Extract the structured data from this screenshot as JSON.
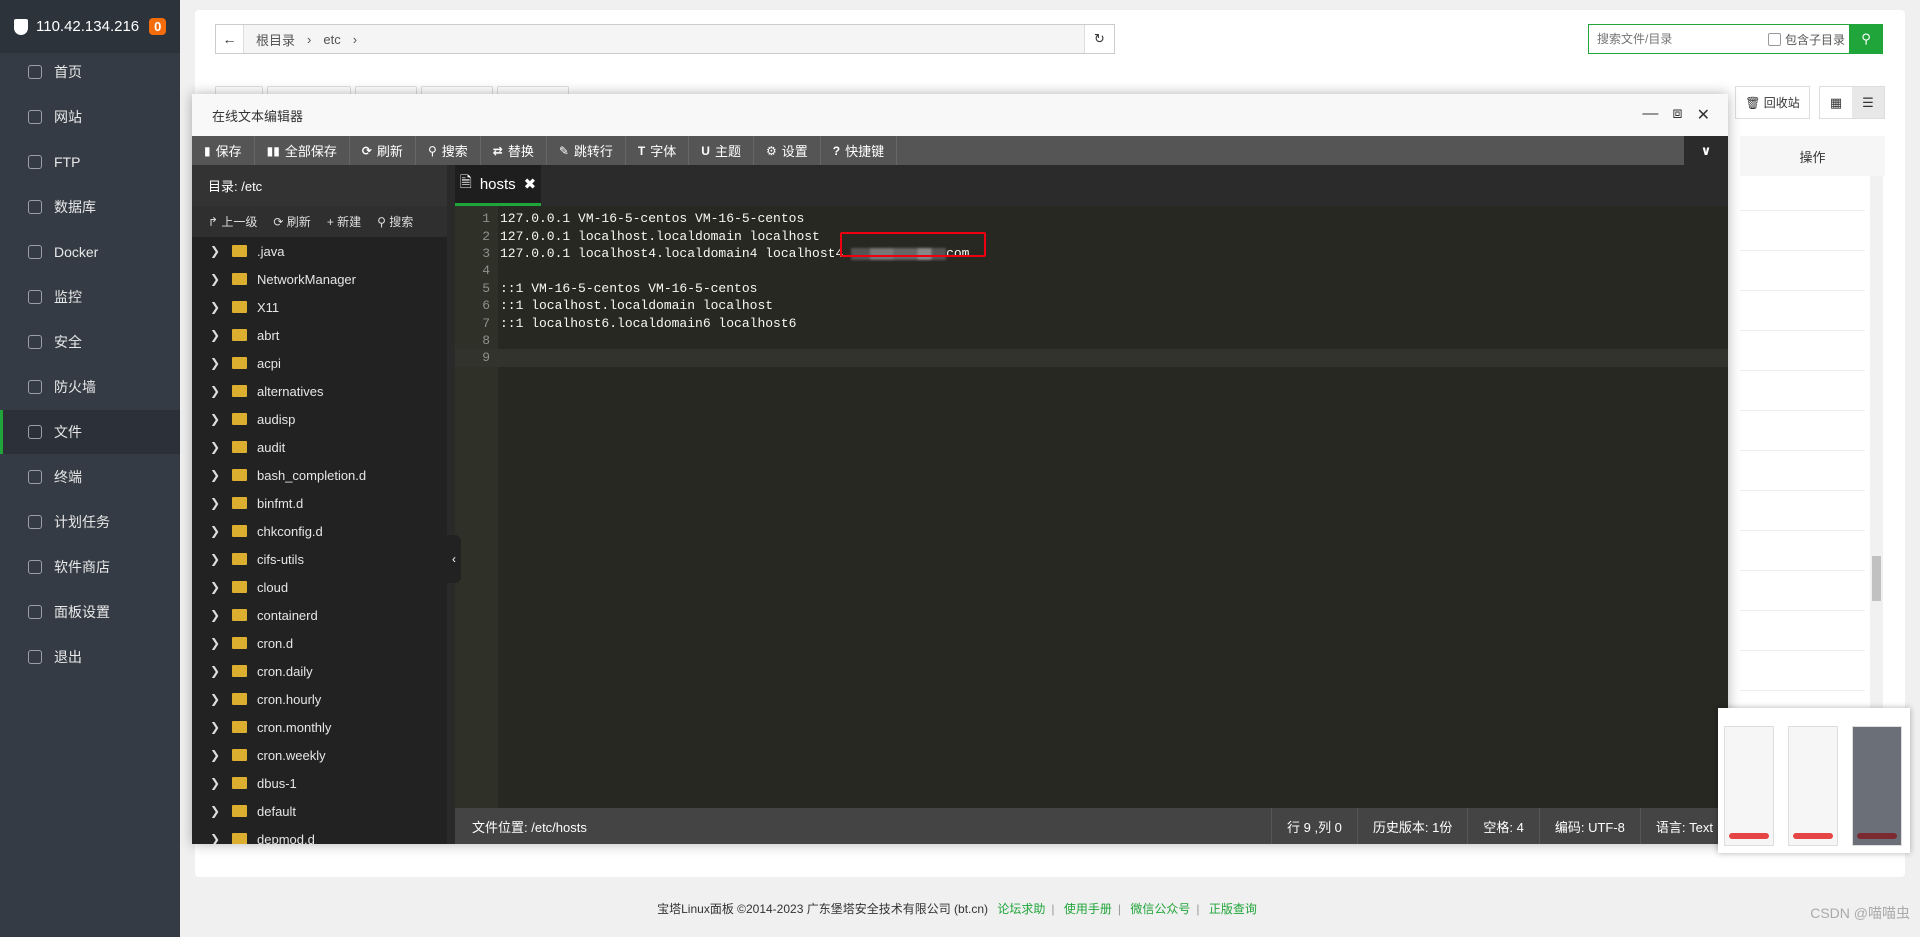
{
  "sidebar": {
    "server_ip": "110.42.134.216",
    "badge": "0",
    "active": "文件",
    "items": [
      {
        "label": "首页",
        "icon": "home-icon"
      },
      {
        "label": "网站",
        "icon": "globe-icon"
      },
      {
        "label": "FTP",
        "icon": "ftp-icon"
      },
      {
        "label": "数据库",
        "icon": "database-icon"
      },
      {
        "label": "Docker",
        "icon": "docker-icon"
      },
      {
        "label": "监控",
        "icon": "monitor-icon"
      },
      {
        "label": "安全",
        "icon": "shield-icon"
      },
      {
        "label": "防火墙",
        "icon": "firewall-icon"
      },
      {
        "label": "文件",
        "icon": "folder-icon"
      },
      {
        "label": "终端",
        "icon": "terminal-icon"
      },
      {
        "label": "计划任务",
        "icon": "calendar-icon"
      },
      {
        "label": "软件商店",
        "icon": "apps-icon"
      },
      {
        "label": "面板设置",
        "icon": "gear-icon"
      },
      {
        "label": "退出",
        "icon": "logout-icon"
      }
    ]
  },
  "files": {
    "breadcrumb": [
      "根目录",
      "etc"
    ],
    "search_placeholder": "搜索文件/目录",
    "include_subdir": "包含子目录",
    "recycle": "回收站",
    "col_actions": "操作"
  },
  "editor": {
    "title": "在线文本编辑器",
    "toolbar": [
      {
        "label": "保存",
        "icon": "save-icon"
      },
      {
        "label": "全部保存",
        "icon": "save-all-icon"
      },
      {
        "label": "刷新",
        "icon": "refresh-icon"
      },
      {
        "label": "搜索",
        "icon": "search-icon"
      },
      {
        "label": "替换",
        "icon": "replace-icon"
      },
      {
        "label": "跳转行",
        "icon": "pin-icon"
      },
      {
        "label": "字体",
        "icon": "font-icon"
      },
      {
        "label": "主题",
        "icon": "magnet-icon"
      },
      {
        "label": "设置",
        "icon": "gear-icon"
      },
      {
        "label": "快捷键",
        "icon": "help-icon"
      }
    ],
    "tree": {
      "dir_label": "目录: /etc",
      "actions": [
        "上一级",
        "刷新",
        "新建",
        "搜索"
      ],
      "nodes": [
        ".java",
        "NetworkManager",
        "X11",
        "abrt",
        "acpi",
        "alternatives",
        "audisp",
        "audit",
        "bash_completion.d",
        "binfmt.d",
        "chkconfig.d",
        "cifs-utils",
        "cloud",
        "containerd",
        "cron.d",
        "cron.daily",
        "cron.hourly",
        "cron.monthly",
        "cron.weekly",
        "dbus-1",
        "default",
        "depmod.d"
      ]
    },
    "tab": "hosts",
    "lines": [
      "127.0.0.1 VM-16-5-centos VM-16-5-centos",
      "127.0.0.1 localhost.localdomain localhost",
      "127.0.0.1 localhost4.localdomain4 localhost4 ",
      "",
      "::1 VM-16-5-centos VM-16-5-centos",
      "::1 localhost.localdomain localhost",
      "::1 localhost6.localdomain6 localhost6",
      "",
      ""
    ],
    "line3_suffix": "com",
    "status": {
      "path": "文件位置: /etc/hosts",
      "cursor": "行 9 ,列 0",
      "history": "历史版本: 1份",
      "spaces": "空格: 4",
      "encoding": "编码: UTF-8",
      "language": "语言: Text"
    }
  },
  "footer": {
    "copyright": "宝塔Linux面板 ©2014-2023 广东堡塔安全技术有限公司 (bt.cn)",
    "links": [
      "论坛求助",
      "使用手册",
      "微信公众号",
      "正版查询"
    ]
  },
  "watermark": "CSDN @喵喵虫",
  "colors": {
    "accent": "#20a53a",
    "badge": "#f56c0a",
    "highlight_box": "#e01"
  }
}
